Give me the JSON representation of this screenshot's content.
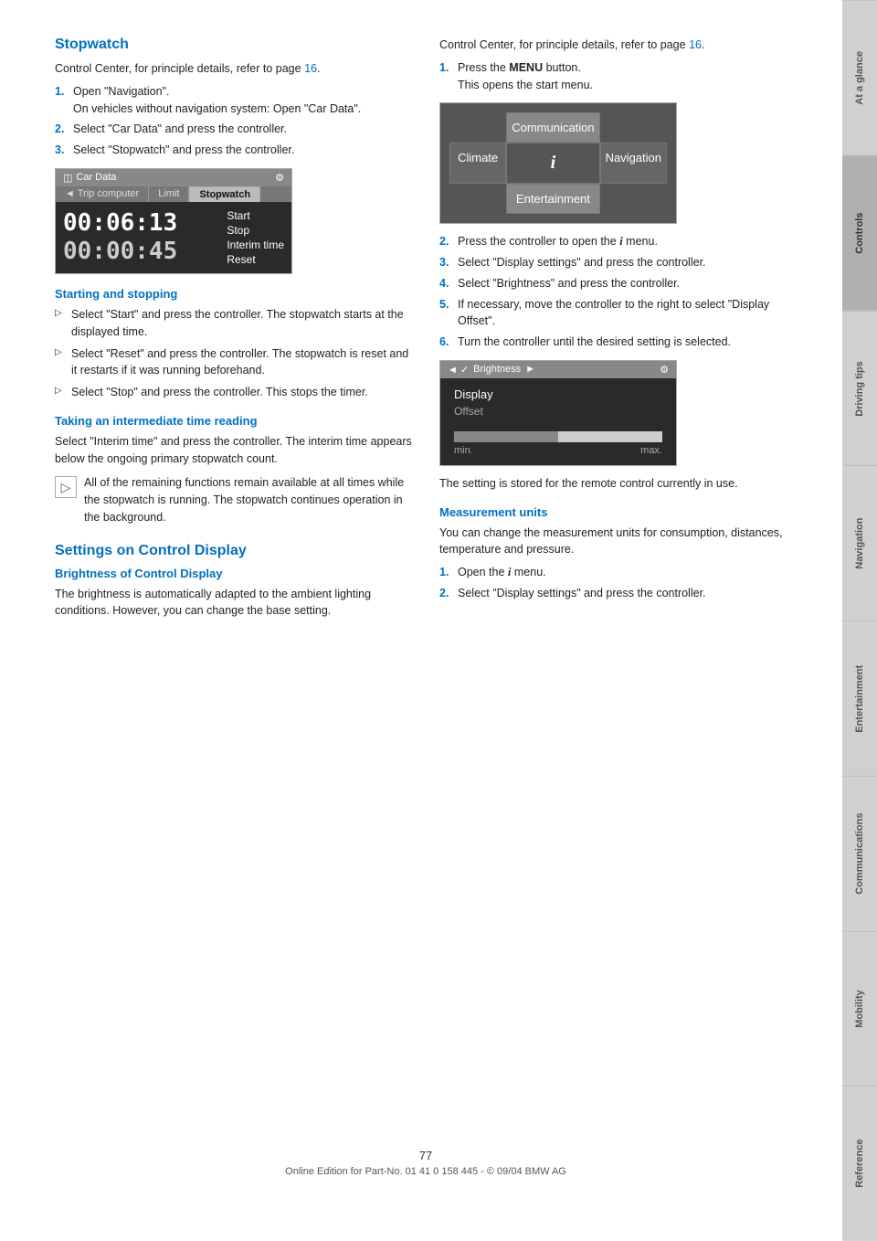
{
  "page": {
    "number": "77",
    "footer_text": "Online Edition for Part-No. 01 41 0 158 445 - © 09/04 BMW AG"
  },
  "side_tabs": [
    {
      "id": "at-a-glance",
      "label": "At a glance",
      "active": false
    },
    {
      "id": "controls",
      "label": "Controls",
      "active": true
    },
    {
      "id": "driving-tips",
      "label": "Driving tips",
      "active": false
    },
    {
      "id": "navigation",
      "label": "Navigation",
      "active": false
    },
    {
      "id": "entertainment",
      "label": "Entertainment",
      "active": false
    },
    {
      "id": "communications",
      "label": "Communications",
      "active": false
    },
    {
      "id": "mobility",
      "label": "Mobility",
      "active": false
    },
    {
      "id": "reference",
      "label": "Reference",
      "active": false
    }
  ],
  "left_col": {
    "stopwatch": {
      "title": "Stopwatch",
      "intro": "Control Center, for principle details, refer to page",
      "intro_link": "16",
      "intro_suffix": ".",
      "steps": [
        {
          "num": "1.",
          "text": "Open \"Navigation\".",
          "subtext": "On vehicles without navigation system: Open \"Car Data\"."
        },
        {
          "num": "2.",
          "text": "Select \"Car Data\" and press the controller."
        },
        {
          "num": "3.",
          "text": "Select \"Stopwatch\" and press the controller."
        }
      ],
      "display": {
        "title": "Car Data",
        "tabs": [
          "Trip computer",
          "Limit",
          "Stopwatch"
        ],
        "active_tab": "Stopwatch",
        "time_main": "00:06:13",
        "time_secondary": "00:00:45",
        "controls": [
          "Start",
          "Stop",
          "Interim time",
          "Reset"
        ]
      }
    },
    "starting_stopping": {
      "title": "Starting and stopping",
      "items": [
        {
          "text": "Select \"Start\" and press the controller. The stopwatch starts at the displayed time."
        },
        {
          "text": "Select \"Reset\" and press the controller. The stopwatch is reset and it restarts if it was running beforehand."
        },
        {
          "text": "Select \"Stop\" and press the controller. This stops the timer."
        }
      ]
    },
    "interim_time": {
      "title": "Taking an intermediate time reading",
      "text1": "Select \"Interim time\" and press the controller. The interim time appears below the ongoing primary stopwatch count.",
      "note": "All of the remaining functions remain available at all times while the stopwatch is running. The stopwatch continues operation in the background."
    },
    "settings_section": {
      "title": "Settings on Control Display"
    },
    "brightness": {
      "title": "Brightness of Control Display",
      "text": "The brightness is automatically adapted to the ambient lighting conditions. However, you can change the base setting."
    }
  },
  "right_col": {
    "intro": "Control Center, for principle details, refer to page",
    "intro_link": "16",
    "intro_suffix": ".",
    "steps": [
      {
        "num": "1.",
        "text": "Press the",
        "bold_word": "MENU",
        "text_after": "button.",
        "subtext": "This opens the start menu."
      }
    ],
    "comm_display": {
      "communication": "Communication",
      "climate": "Climate",
      "navigation": "Navigation",
      "entertainment": "Entertainment",
      "center_symbol": "i"
    },
    "steps2": [
      {
        "num": "2.",
        "text": "Press the controller to open the",
        "icon": "i",
        "text_after": "menu."
      },
      {
        "num": "3.",
        "text": "Select \"Display settings\" and press the controller."
      },
      {
        "num": "4.",
        "text": "Select \"Brightness\" and press the controller."
      },
      {
        "num": "5.",
        "text": "If necessary, move the controller to the right to select \"Display Offset\"."
      },
      {
        "num": "6.",
        "text": "Turn the controller until the desired setting is selected."
      }
    ],
    "brightness_display": {
      "title": "Brightness",
      "display_label": "Display",
      "offset_label": "Offset",
      "min_label": "min.",
      "max_label": "max."
    },
    "setting_stored": "The setting is stored for the remote control currently in use.",
    "measurement": {
      "title": "Measurement units",
      "text": "You can change the measurement units for consumption, distances, temperature and pressure.",
      "steps": [
        {
          "num": "1.",
          "text": "Open the",
          "icon": "i",
          "text_after": "menu."
        },
        {
          "num": "2.",
          "text": "Select \"Display settings\" and press the controller."
        }
      ]
    }
  }
}
